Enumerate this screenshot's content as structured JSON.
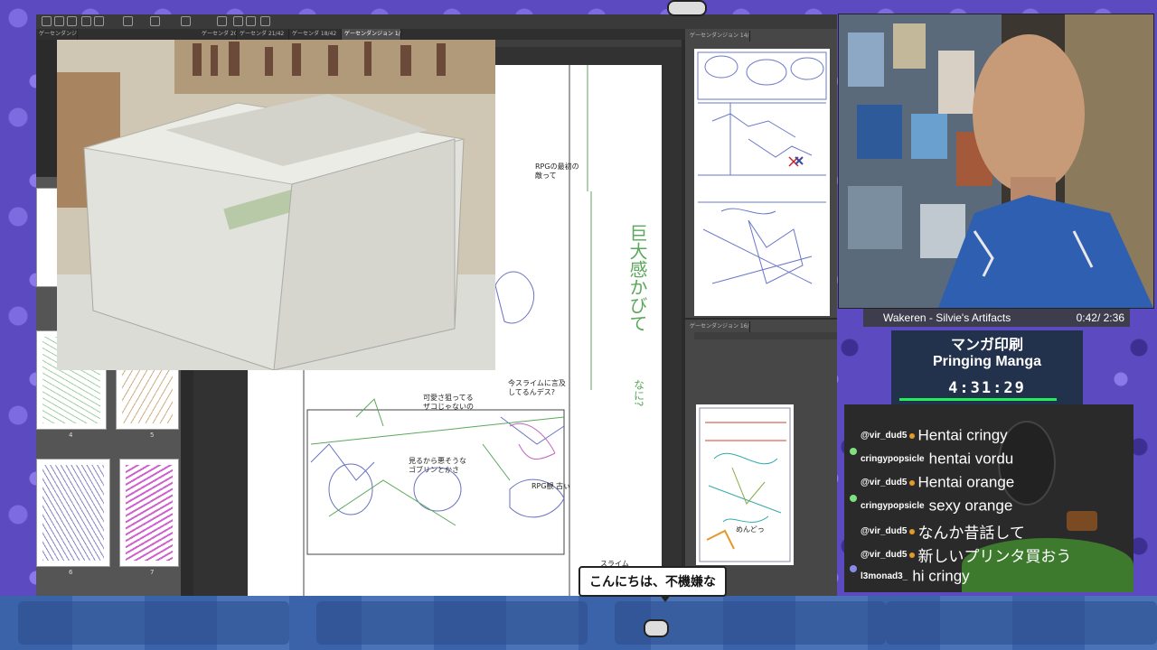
{
  "app": {
    "tabs": [
      {
        "label": "ゲーセンダンジョン"
      },
      {
        "label": "ゲーセンダ 20/42"
      },
      {
        "label": "ゲーセンダ 21/42"
      },
      {
        "label": "ゲーセンダ 18/42"
      },
      {
        "label": "ゲーセンダンジョン 1/42",
        "active": true
      }
    ],
    "right_panel_tabs": [
      {
        "label": "ゲーセンダンジョン 14/42"
      },
      {
        "label": "ゲーセンダンジョン 16/42"
      }
    ],
    "thumbnail_numbers": [
      "4",
      "5",
      "6",
      "7"
    ],
    "sketch_texts": [
      "RPGの最初の\n敵って",
      "可愛さ狙ってる\nザコじゃないの",
      "見るから悪そうな\nゴブリンとかさ",
      "今スライムに言及\nしてるんデス?",
      "RPG観 古ぃ",
      "スライム\nディスってるか",
      "めんどっ",
      "巨大感かびて",
      "なに?"
    ]
  },
  "song": {
    "title": "Wakeren - Silvie's Artifacts",
    "time": "0:42/ 2:36"
  },
  "stream_title": {
    "jp": "マンガ印刷",
    "en": "Pringing Manga",
    "timer": "4:31:29"
  },
  "chat": [
    {
      "user": "@vir_dud5",
      "message": "Hentai cringy"
    },
    {
      "user": "cringypopsicle",
      "message": "hentai vordu"
    },
    {
      "user": "@vir_dud5",
      "message": "Hentai orange"
    },
    {
      "user": "cringypopsicle",
      "message": "sexy orange"
    },
    {
      "user": "@vir_dud5",
      "message": "なんか昔話して"
    },
    {
      "user": "@vir_dud5",
      "message": "新しいプリンタ買おう"
    },
    {
      "user": "l3monad3_",
      "message": "hi cringy"
    }
  ],
  "caption": "こんにちは、不機嫌な",
  "colors": {
    "background": "#5b4ac0",
    "accent_green": "#1ff05a",
    "title_box": "#22314c"
  }
}
